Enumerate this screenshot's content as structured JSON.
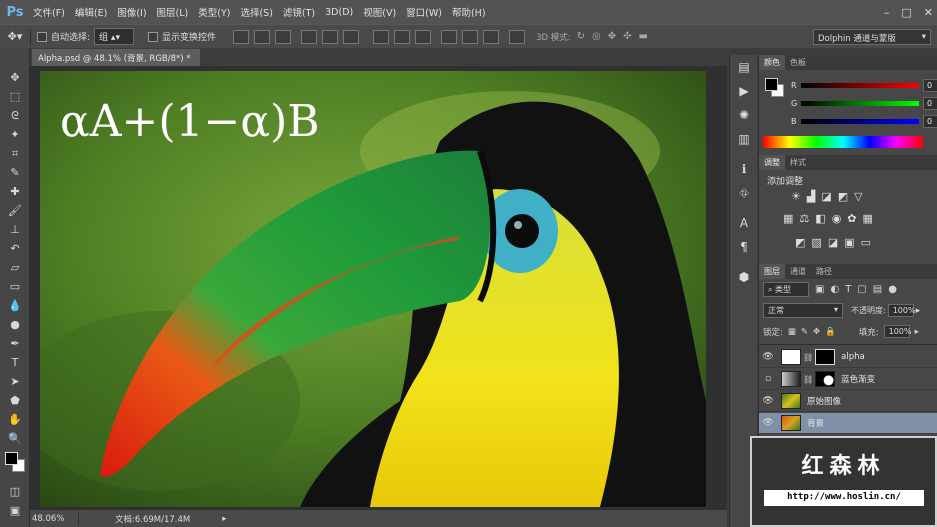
{
  "app": {
    "logo": "Ps",
    "menu": [
      "文件(F)",
      "编辑(E)",
      "图像(I)",
      "图层(L)",
      "类型(Y)",
      "选择(S)",
      "滤镜(T)",
      "3D(D)",
      "视图(V)",
      "窗口(W)",
      "帮助(H)"
    ],
    "window_controls": [
      "–",
      "□",
      "✕"
    ]
  },
  "options_bar": {
    "auto_select_label": "自动选择:",
    "auto_select_value": "组",
    "show_transform_label": "显示变换控件",
    "mode_3d_label": "3D 模式:",
    "workspace": "Dolphin 通道与蒙版"
  },
  "document": {
    "tab_title": "Alpha.psd @ 48.1% (背景, RGB/8*) *",
    "tab_close": "×",
    "formula": "αA+(1−α)B"
  },
  "status": {
    "zoom": "48.06%",
    "doc_info": "文档:6.69M/17.4M"
  },
  "color_panel": {
    "tabs": [
      "颜色",
      "色板"
    ],
    "channels": [
      {
        "label": "R",
        "value": "0",
        "color": "#d23a3a"
      },
      {
        "label": "G",
        "value": "0",
        "color": "#3aa83a"
      },
      {
        "label": "B",
        "value": "0",
        "color": "#3a4ad2"
      }
    ]
  },
  "adjust_panel": {
    "tabs": [
      "调整",
      "样式"
    ],
    "title": "添加调整"
  },
  "layers_panel": {
    "tabs": [
      "图层",
      "通道",
      "路径"
    ],
    "kind_filter": "类型",
    "blend_mode": "正常",
    "opacity_label": "不透明度:",
    "opacity_value": "100%",
    "lock_label": "锁定:",
    "fill_label": "填充:",
    "fill_value": "100%",
    "layers": [
      {
        "name": "alpha",
        "visible": true,
        "selected": false
      },
      {
        "name": "蓝色渐变",
        "visible": false,
        "selected": false
      },
      {
        "name": "原始图像",
        "visible": true,
        "selected": false
      },
      {
        "name": "背景",
        "visible": true,
        "selected": true
      }
    ]
  },
  "watermark": {
    "name": "红森林",
    "url": "http://www.hoslin.cn/"
  }
}
